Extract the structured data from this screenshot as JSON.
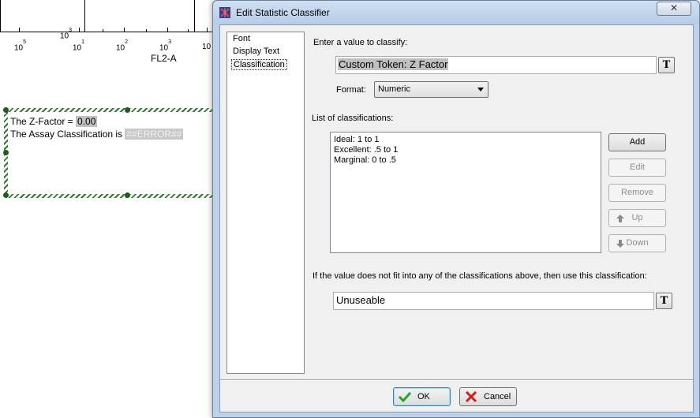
{
  "background": {
    "x_axis_ticks": [
      {
        "base": "10",
        "exp": "5"
      },
      {
        "base": "10",
        "exp": "1"
      },
      {
        "base": "10",
        "exp": "2"
      },
      {
        "base": "10",
        "exp": "3"
      },
      {
        "base": "10",
        "exp": ""
      }
    ],
    "x_axis_extra_tick": {
      "base": "10",
      "exp": "3"
    },
    "x_axis_title": "FL2-A",
    "text_box": {
      "line1_prefix": "The Z-Factor = ",
      "line1_value": "0.00",
      "line2_prefix": "The Assay Classification is ",
      "line2_value": "##ERROR##"
    }
  },
  "dialog": {
    "title": "Edit Statistic Classifier",
    "close_symbol": "✕",
    "nav_items": [
      {
        "label": "Font",
        "selected": false
      },
      {
        "label": "Display Text",
        "selected": false
      },
      {
        "label": "Classification",
        "selected": true
      }
    ],
    "value_label": "Enter a value to classify:",
    "value_field": "Custom Token: Z Factor",
    "token_button": "T",
    "format_label": "Format:",
    "format_value": "Numeric",
    "list_label": "List of classifications:",
    "classifications": [
      "Ideal: 1 to 1",
      "Excellent: .5 to 1",
      "Marginal: 0 to .5"
    ],
    "buttons": {
      "add": "Add",
      "edit": "Edit",
      "remove": "Remove",
      "up": "Up",
      "down": "Down"
    },
    "fallback_label": "If the value does not fit into any of the classifications above, then use this classification:",
    "fallback_value": "Unuseable",
    "ok": "OK",
    "cancel": "Cancel"
  },
  "colors": {
    "titlebar": "#bcd1ea",
    "selection_green": "#2f7a2f",
    "ok_check": "#2fa02f",
    "cancel_x": "#d02020"
  }
}
